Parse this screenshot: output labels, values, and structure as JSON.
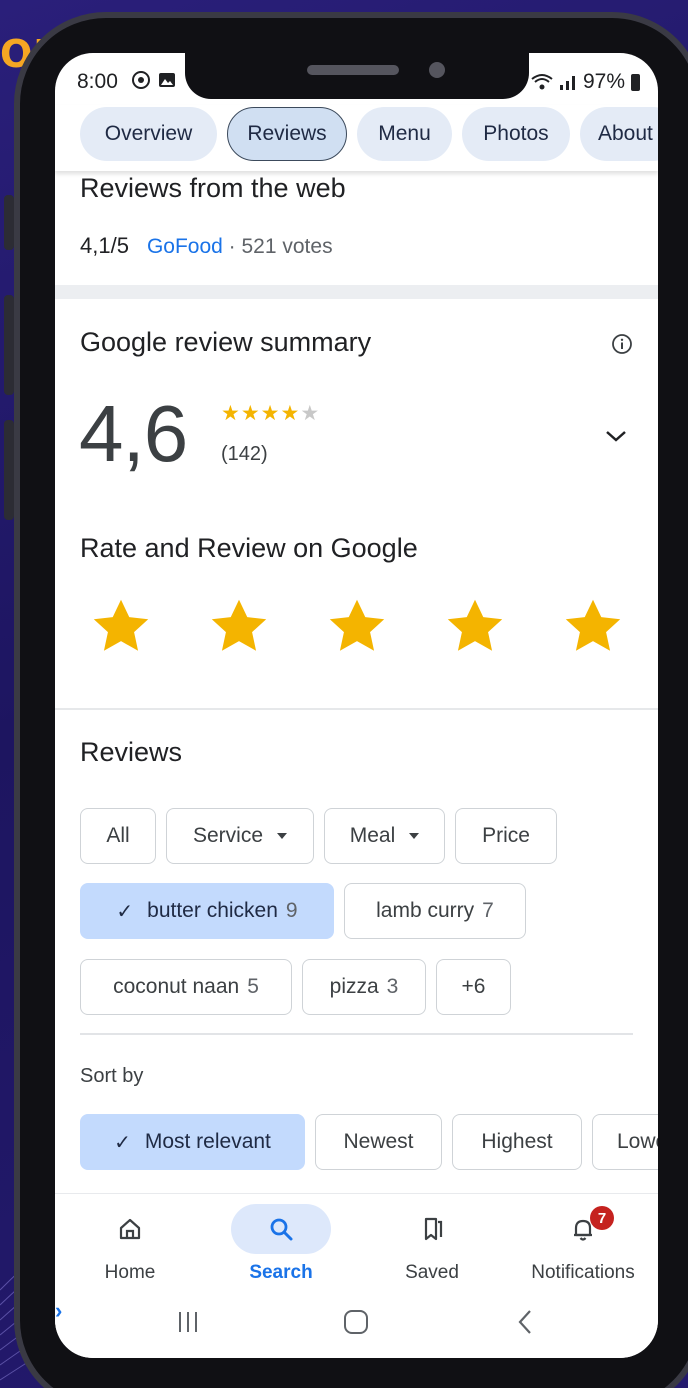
{
  "brand": {
    "text": "OB"
  },
  "status_bar": {
    "time": "8:00",
    "battery": "97%",
    "colors": {
      "text": "#202124"
    }
  },
  "place_tabs": [
    {
      "label": "Overview",
      "active": false
    },
    {
      "label": "Reviews",
      "active": true
    },
    {
      "label": "Menu",
      "active": false
    },
    {
      "label": "Photos",
      "active": false
    },
    {
      "label": "About",
      "active": false
    }
  ],
  "web_reviews": {
    "title": "Reviews from the web",
    "score": "4,1/5",
    "source": "GoFood",
    "votes": "· 521 votes"
  },
  "summary": {
    "title": "Google review summary",
    "rating": "4,6",
    "stars_rating": 4.6,
    "stars_full": "★★★★",
    "stars_half": "★",
    "count": "(142)"
  },
  "rate": {
    "title": "Rate and Review on Google",
    "star_color": "#f4b400",
    "star_count": 5
  },
  "reviews": {
    "title": "Reviews",
    "filters": [
      {
        "label": "All",
        "count": "",
        "dropdown": false
      },
      {
        "label": "Service",
        "count": "",
        "dropdown": true
      },
      {
        "label": "Meal",
        "count": "",
        "dropdown": true
      },
      {
        "label": "Price",
        "count": "",
        "dropdown": false
      }
    ],
    "topics": [
      {
        "label": "butter chicken",
        "count": "9",
        "selected": true
      },
      {
        "label": "lamb curry",
        "count": "7",
        "selected": false
      },
      {
        "label": "coconut naan",
        "count": "5",
        "selected": false
      },
      {
        "label": "pizza",
        "count": "3",
        "selected": false
      },
      {
        "label": "+6",
        "count": "",
        "selected": false
      }
    ],
    "check_mark": "✓"
  },
  "sort": {
    "label": "Sort by",
    "options": [
      {
        "label": "Most relevant",
        "selected": true
      },
      {
        "label": "Newest",
        "selected": false
      },
      {
        "label": "Highest",
        "selected": false
      },
      {
        "label": "Lowest",
        "selected": false
      }
    ]
  },
  "bottom_nav": [
    {
      "label": "Home",
      "icon": "home-icon",
      "active": false
    },
    {
      "label": "Search",
      "icon": "search-icon",
      "active": true
    },
    {
      "label": "Saved",
      "icon": "bookmark-icon",
      "active": false
    },
    {
      "label": "Notifications",
      "icon": "bell-icon",
      "active": false,
      "badge": "7"
    }
  ],
  "colors": {
    "accent": "#1a73e8",
    "selected_chip": "#c3dafd",
    "tab_bg": "#e4ebf6",
    "badge": "#c5221f"
  }
}
